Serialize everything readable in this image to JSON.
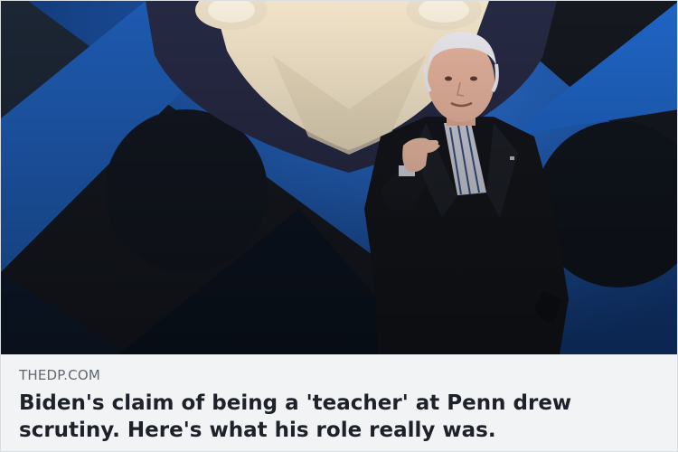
{
  "link_preview": {
    "domain": "THEDP.COM",
    "headline": "Biden's claim of being a 'teacher' at Penn drew scrutiny. Here's what his role really was."
  },
  "colors": {
    "caption_background": "#f2f3f5",
    "domain_text": "#606770",
    "headline_text": "#1d2129",
    "stage_blue": "#1d5fb5",
    "stage_dark": "#141820",
    "shield_cream": "#f3e6cd",
    "shield_navy": "#2a2c4a"
  }
}
